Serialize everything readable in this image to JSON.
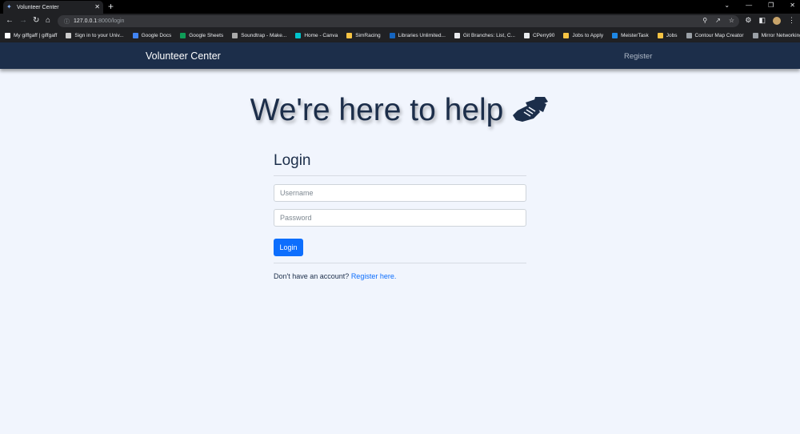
{
  "browser": {
    "tab_title": "Volunteer Center",
    "url_host": "127.0.0.1",
    "url_path": ":8000/login",
    "bookmarks": [
      {
        "label": "My giffgaff | giffgaff",
        "color": "#ffffff"
      },
      {
        "label": "Sign in to your Univ...",
        "color": "#cccccc"
      },
      {
        "label": "Google Docs",
        "color": "#4285f4"
      },
      {
        "label": "Google Sheets",
        "color": "#0f9d58"
      },
      {
        "label": "Soundtrap - Make...",
        "color": "#aaaaaa"
      },
      {
        "label": "Home - Canva",
        "color": "#00c4cc"
      },
      {
        "label": "SimRacing",
        "color": "#f6c343"
      },
      {
        "label": "Libraries Unlimited...",
        "color": "#1565c0"
      },
      {
        "label": "Git Branches: List, C...",
        "color": "#e8eaed"
      },
      {
        "label": "CPerry90",
        "color": "#e8eaed"
      },
      {
        "label": "Jobs to Apply",
        "color": "#f6c343"
      },
      {
        "label": "MeisterTask",
        "color": "#1e88e5"
      },
      {
        "label": "Jobs",
        "color": "#f6c343"
      },
      {
        "label": "Contour Map Creator",
        "color": "#9aa0a6"
      },
      {
        "label": "Mirror Networking...",
        "color": "#9aa0a6"
      }
    ]
  },
  "navbar": {
    "brand": "Volunteer Center",
    "register_link": "Register"
  },
  "hero": {
    "title": "We're here to help",
    "icon": "handshake-icon"
  },
  "login": {
    "title": "Login",
    "username_placeholder": "Username",
    "password_placeholder": "Password",
    "button_label": "Login",
    "signup_prompt": "Don't have an account?",
    "signup_link": "Register here."
  },
  "colors": {
    "navbar_bg": "#1c2e4a",
    "page_bg": "#f1f5fd",
    "primary": "#0d6efd"
  }
}
